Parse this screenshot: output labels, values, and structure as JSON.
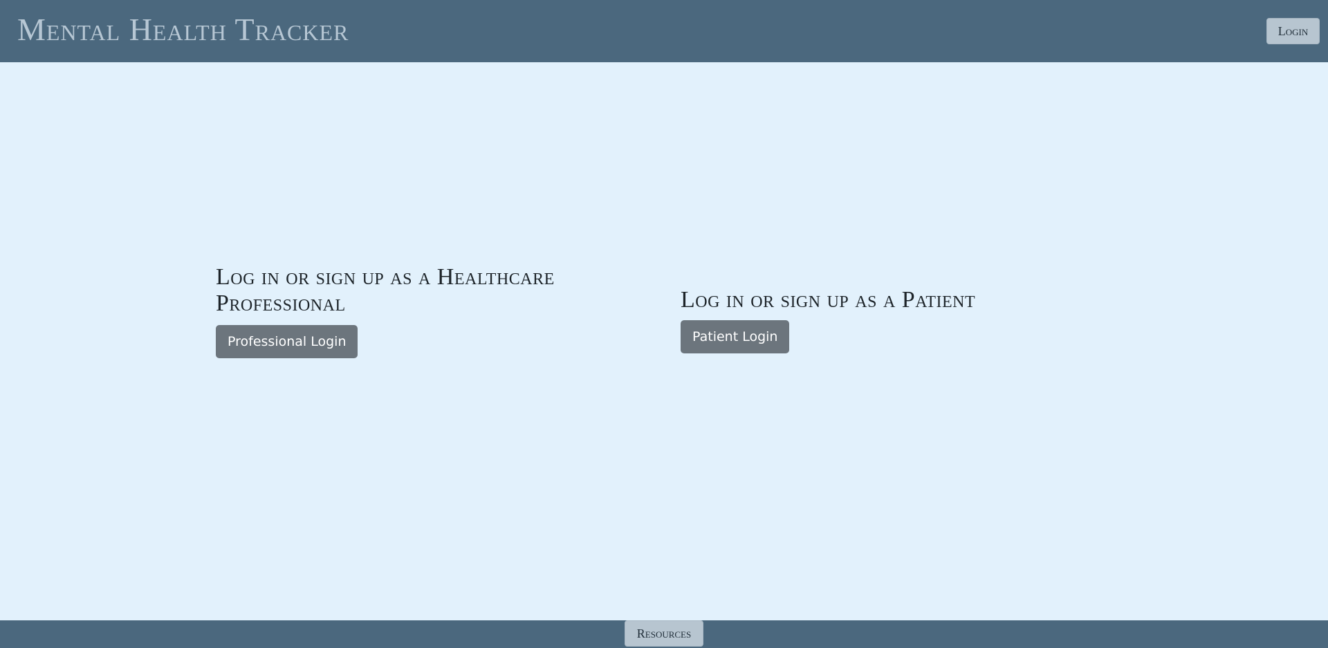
{
  "header": {
    "title": "Mental Health Tracker",
    "login_label": "Login"
  },
  "main": {
    "professional": {
      "heading": "Log in or sign up as a Healthcare Professional",
      "button_label": "Professional Login"
    },
    "patient": {
      "heading": "Log in or sign up as a Patient",
      "button_label": "Patient Login"
    }
  },
  "footer": {
    "resources_label": "Resources"
  },
  "colors": {
    "navbar": "#4b687e",
    "background": "#e2f1fc",
    "primary_button": "#6c757d",
    "light_button": "#b7c5d0"
  }
}
